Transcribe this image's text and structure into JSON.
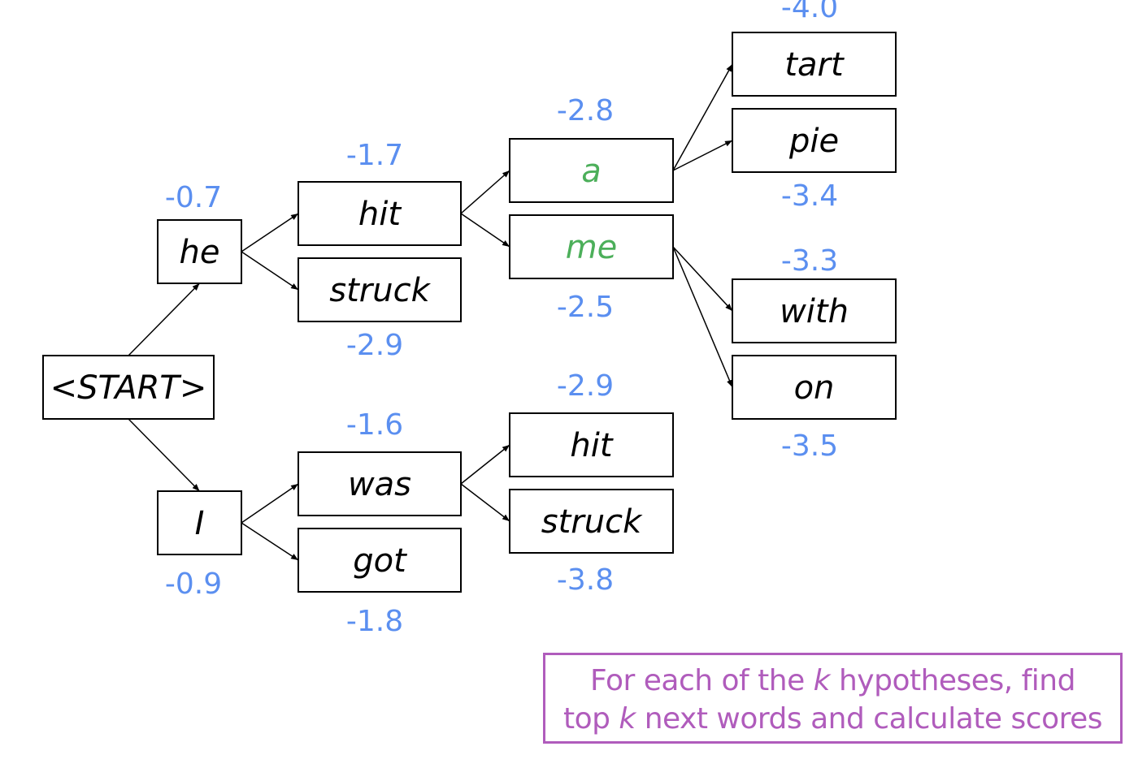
{
  "colors": {
    "score": "#5b8ff0",
    "highlight": "#4caf5a",
    "word": "#000000",
    "note": "#b05cbc"
  },
  "nodes": {
    "start": {
      "word": "<START>",
      "score": null,
      "style": "normal",
      "children": [
        "he",
        "I"
      ]
    },
    "he": {
      "word": "he",
      "score": "-0.7",
      "style": "normal",
      "children": [
        "hit",
        "struck"
      ]
    },
    "I": {
      "word": "I",
      "score": "-0.9",
      "style": "normal",
      "children": [
        "was",
        "got"
      ]
    },
    "hit": {
      "word": "hit",
      "score": "-1.7",
      "style": "normal",
      "children": [
        "a",
        "me"
      ]
    },
    "struck": {
      "word": "struck",
      "score": "-2.9",
      "style": "normal",
      "children": []
    },
    "was": {
      "word": "was",
      "score": "-1.6",
      "style": "normal",
      "children": [
        "hit2",
        "struck2"
      ]
    },
    "got": {
      "word": "got",
      "score": "-1.8",
      "style": "normal",
      "children": []
    },
    "a": {
      "word": "a",
      "score": "-2.8",
      "style": "highlight",
      "children": [
        "tart",
        "pie"
      ]
    },
    "me": {
      "word": "me",
      "score": "-2.5",
      "style": "highlight",
      "children": [
        "with",
        "on"
      ]
    },
    "hit2": {
      "word": "hit",
      "score": "-2.9",
      "style": "normal",
      "children": []
    },
    "struck2": {
      "word": "struck",
      "score": "-3.8",
      "style": "normal",
      "children": []
    },
    "tart": {
      "word": "tart",
      "score": "-4.0",
      "style": "normal",
      "children": []
    },
    "pie": {
      "word": "pie",
      "score": "-3.4",
      "style": "normal",
      "children": []
    },
    "with": {
      "word": "with",
      "score": "-3.3",
      "style": "normal",
      "children": []
    },
    "on": {
      "word": "on",
      "score": "-3.5",
      "style": "normal",
      "children": []
    }
  },
  "note": {
    "line1_a": "For each of the ",
    "k": "k",
    "line1_b": " hypotheses, find",
    "line2_a": "top ",
    "line2_b": " next words and calculate scores"
  }
}
